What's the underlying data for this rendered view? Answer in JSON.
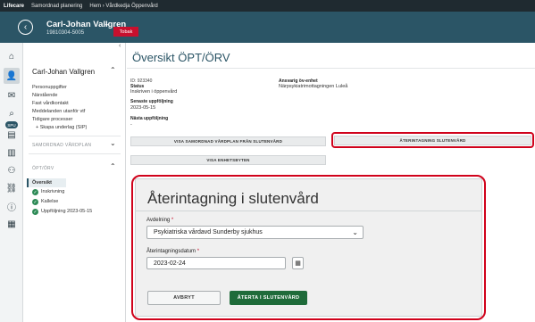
{
  "topbar": {
    "brand": "Lifecare",
    "tabs": [
      "Samordnad planering",
      "Hem › Vårdkedja Öppenvård"
    ]
  },
  "patient": {
    "name": "Carl-Johan Vallgren",
    "id": "19810304-5005",
    "flag": "Tobak"
  },
  "sidebar": {
    "name": "Carl-Johan Vallgren",
    "items": [
      "Personuppgifter",
      "Närstående",
      "Fast vårdkontakt",
      "Meddelanden utanför vtf",
      "Tidigare processer"
    ],
    "create_label": "Skapa underlag (SIP)",
    "section_1": "SAMORDNAD VÅRDPLAN",
    "section_2": "ÖPT/ÖRV",
    "selected": "Översikt",
    "steps": [
      "Inskrivning",
      "Kallelse",
      "Uppföljning 2023-05-15"
    ]
  },
  "iconbar": {
    "badge": "SPU"
  },
  "main": {
    "title": "Översikt ÖPT/ÖRV",
    "id_label": "ID: 923340",
    "status_label": "Status",
    "status_value": "Inskriven i öppenvård",
    "last_followup_label": "Senaste uppföljning",
    "last_followup_value": "2023-05-15",
    "next_followup_label": "Nästa uppföljning",
    "next_followup_value": "-",
    "responsible_label": "Ansvarig öv-enhet",
    "responsible_value": "Närpsykiatrimottagningen Luleå",
    "btn_show_plan": "VISA SAMORDNAD VÅRDPLAN FRÅN SLUTENVÅRD",
    "btn_show_units": "VISA ENHETSBYTEN",
    "btn_readmission": "ÅTERINTAGNING SLUTENVÅRD"
  },
  "modal": {
    "title": "Återintagning i slutenvård",
    "dept_label": "Avdelning",
    "dept_value": "Psykiatriska vårdavd Sunderby sjukhus",
    "date_label": "Återintagningsdatum",
    "date_value": "2023-02-24",
    "required_mark": "*",
    "cancel_label": "AVBRYT",
    "ok_label": "ÅTERTA I SLUTENVÅRD"
  }
}
